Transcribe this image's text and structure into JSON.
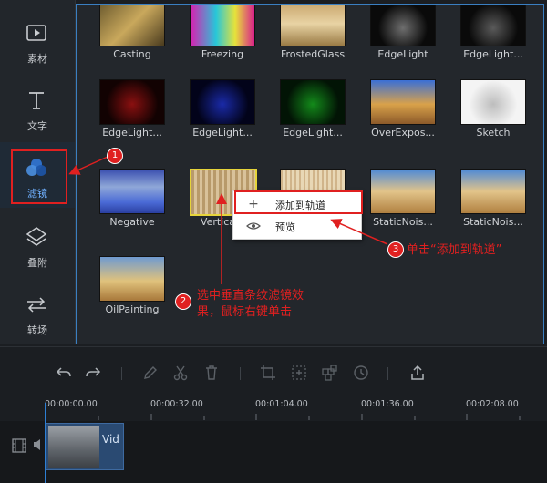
{
  "sidebar": {
    "items": [
      {
        "label": "素材",
        "icon": "media-icon"
      },
      {
        "label": "文字",
        "icon": "text-icon"
      },
      {
        "label": "滤镜",
        "icon": "filter-icon"
      },
      {
        "label": "叠附",
        "icon": "overlay-icon"
      },
      {
        "label": "转场",
        "icon": "transition-icon"
      }
    ]
  },
  "filters": {
    "row1": [
      "Casting",
      "Freezing",
      "FrostedGlass",
      "EdgeLight",
      "EdgeLight..."
    ],
    "row2": [
      "EdgeLight...",
      "EdgeLight...",
      "EdgeLight...",
      "OverExpos...",
      "Sketch"
    ],
    "row3": [
      "Negative",
      "VerticalS",
      "",
      "StaticNois...",
      "StaticNois..."
    ],
    "row4": [
      "OilPainting"
    ]
  },
  "context_menu": {
    "add_to_track": "添加到轨道",
    "preview": "预览"
  },
  "annotations": {
    "badge1": "1",
    "badge2": "2",
    "badge3": "3",
    "note2_line1": "选中垂直条纹滤镜效",
    "note2_line2": "果，鼠标右键单击",
    "note3": "单击“添加到轨道”"
  },
  "timeline": {
    "ticks": [
      "00:00:00.00",
      "00:00:32.00",
      "00:01:04.00",
      "00:01:36.00",
      "00:02:08.00"
    ],
    "clip_label": "Vid"
  },
  "colors": {
    "accent": "#3a7fc2",
    "annotation": "#e02020",
    "selection": "#e6d43a"
  }
}
